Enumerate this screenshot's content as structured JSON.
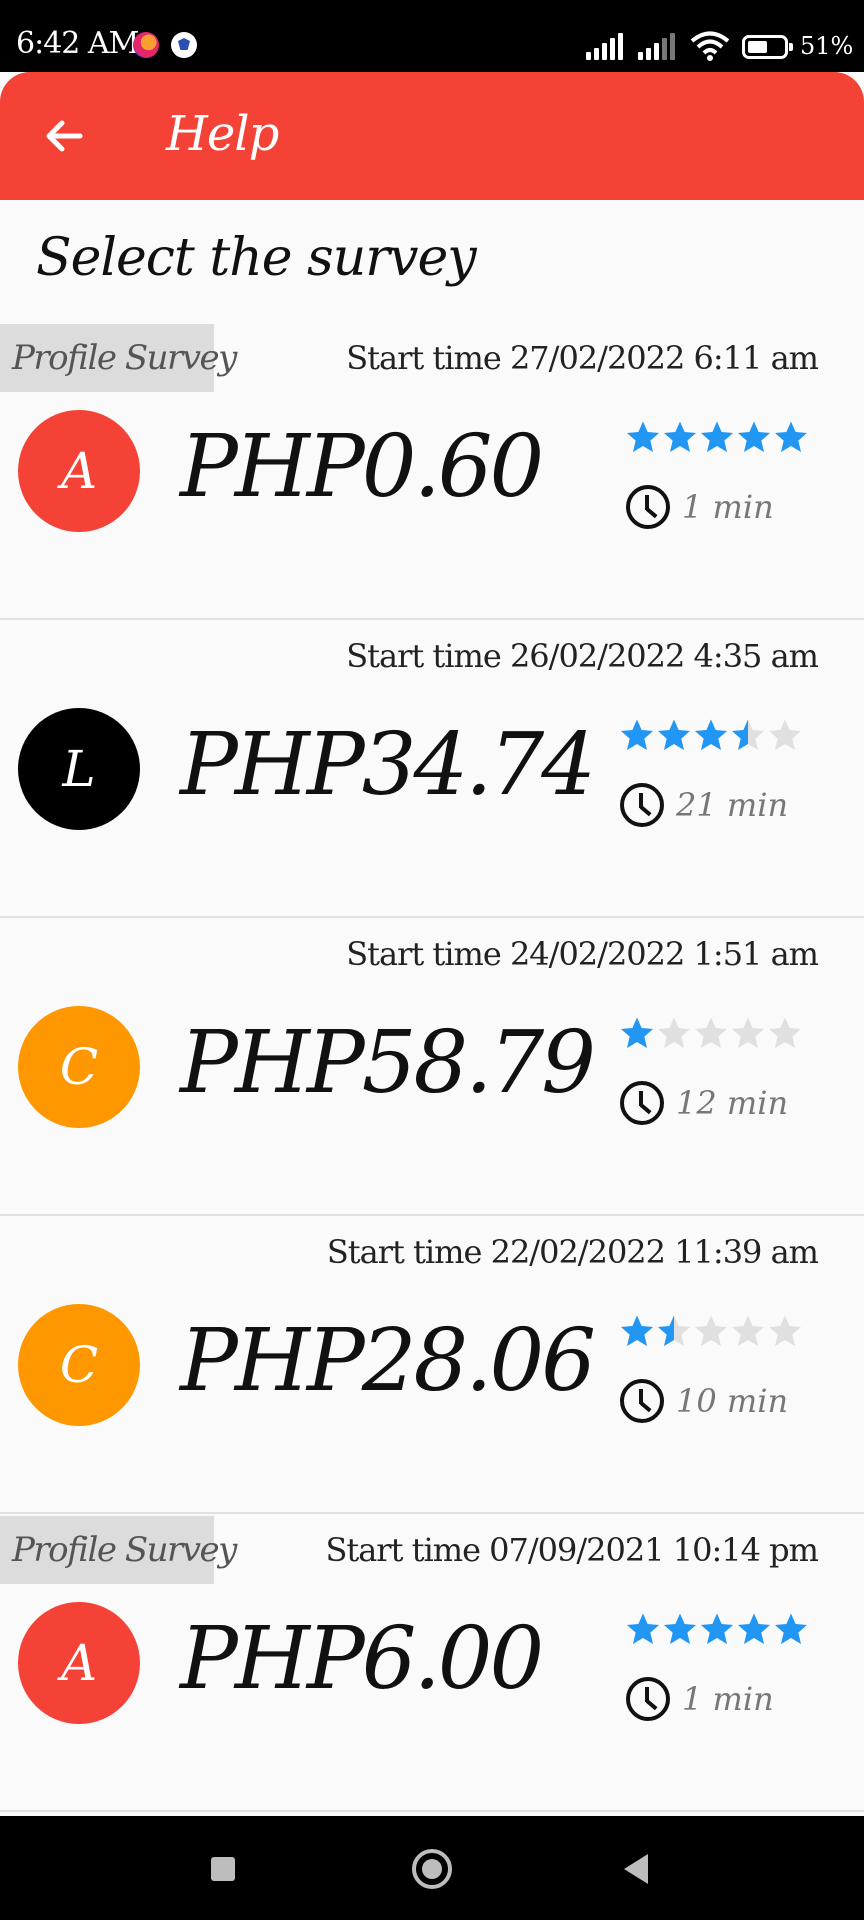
{
  "status_bar": {
    "time": "6:42 AM",
    "battery": "51%"
  },
  "app_bar": {
    "title": "Help",
    "color": "#f44336"
  },
  "heading": "Select the survey",
  "colors": {
    "star_filled": "#2196f3",
    "star_empty": "#e0e0e0"
  },
  "surveys": [
    {
      "tag": "Profile Survey",
      "start_time": "Start time 27/02/2022 6:11 am",
      "avatar_letter": "A",
      "avatar_color": "#f44336",
      "amount": "PHP0.60",
      "rating": 5,
      "duration": "1 min"
    },
    {
      "tag": "",
      "start_time": "Start time 26/02/2022 4:35 am",
      "avatar_letter": "L",
      "avatar_color": "#000000",
      "amount": "PHP34.74",
      "rating": 3.5,
      "duration": "21 min"
    },
    {
      "tag": "",
      "start_time": "Start time 24/02/2022 1:51 am",
      "avatar_letter": "C",
      "avatar_color": "#ff9800",
      "amount": "PHP58.79",
      "rating": 1,
      "duration": "12 min"
    },
    {
      "tag": "",
      "start_time": "Start time 22/02/2022 11:39 am",
      "avatar_letter": "C",
      "avatar_color": "#ff9800",
      "amount": "PHP28.06",
      "rating": 1.5,
      "duration": "10 min"
    },
    {
      "tag": "Profile Survey",
      "start_time": "Start time 07/09/2021 10:14 pm",
      "avatar_letter": "A",
      "avatar_color": "#f44336",
      "amount": "PHP6.00",
      "rating": 5,
      "duration": "1 min"
    }
  ]
}
